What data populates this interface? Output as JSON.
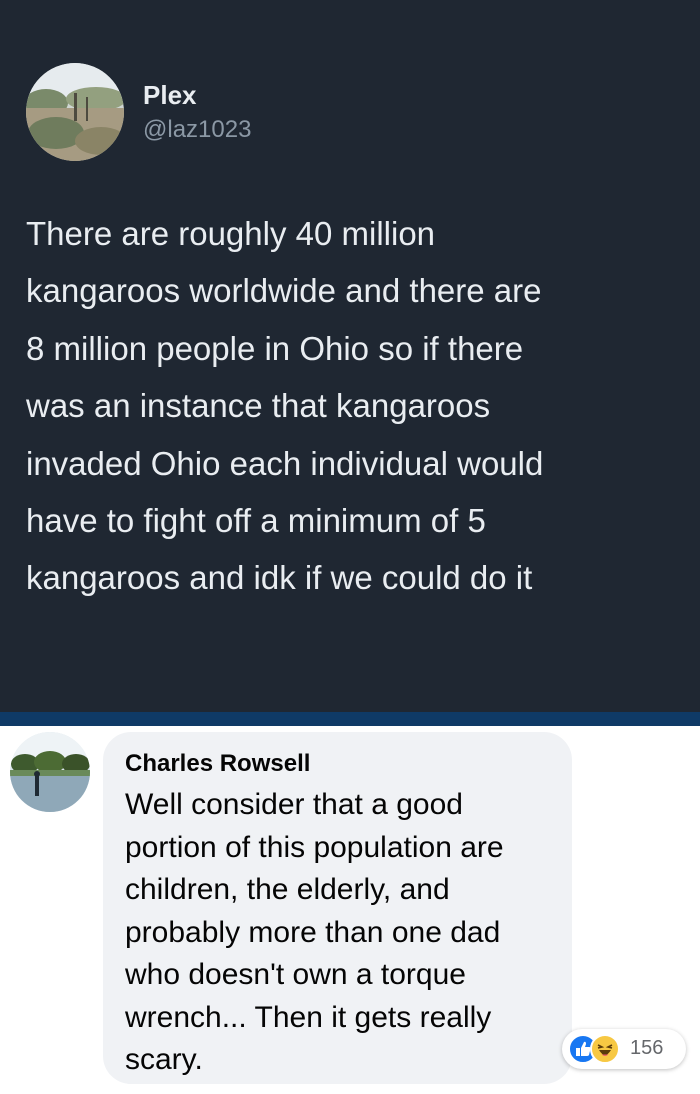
{
  "tweet": {
    "name": "Plex",
    "handle": "@laz1023",
    "lines": [
      "There are roughly 40 million",
      "kangaroos worldwide and there are",
      "8 million people in Ohio so if there",
      "was an instance that kangaroos",
      "invaded Ohio each individual would",
      "have to fight off a minimum of 5",
      "kangaroos and idk if we could do it"
    ]
  },
  "comment": {
    "name": "Charles Rowsell",
    "lines": [
      "Well consider that a good",
      "portion of this population are",
      "children, the elderly, and",
      "probably more than one dad",
      "who doesn't own a torque",
      "wrench... Then it gets really",
      "scary."
    ],
    "reactions": {
      "icons": [
        "like-icon",
        "haha-icon"
      ],
      "count": "156"
    }
  },
  "colors": {
    "tweet_bg": "#1f2732",
    "divider": "#0f3a66",
    "bubble_bg": "#f0f2f5",
    "like": "#1877f2",
    "haha": "#f7c843"
  }
}
